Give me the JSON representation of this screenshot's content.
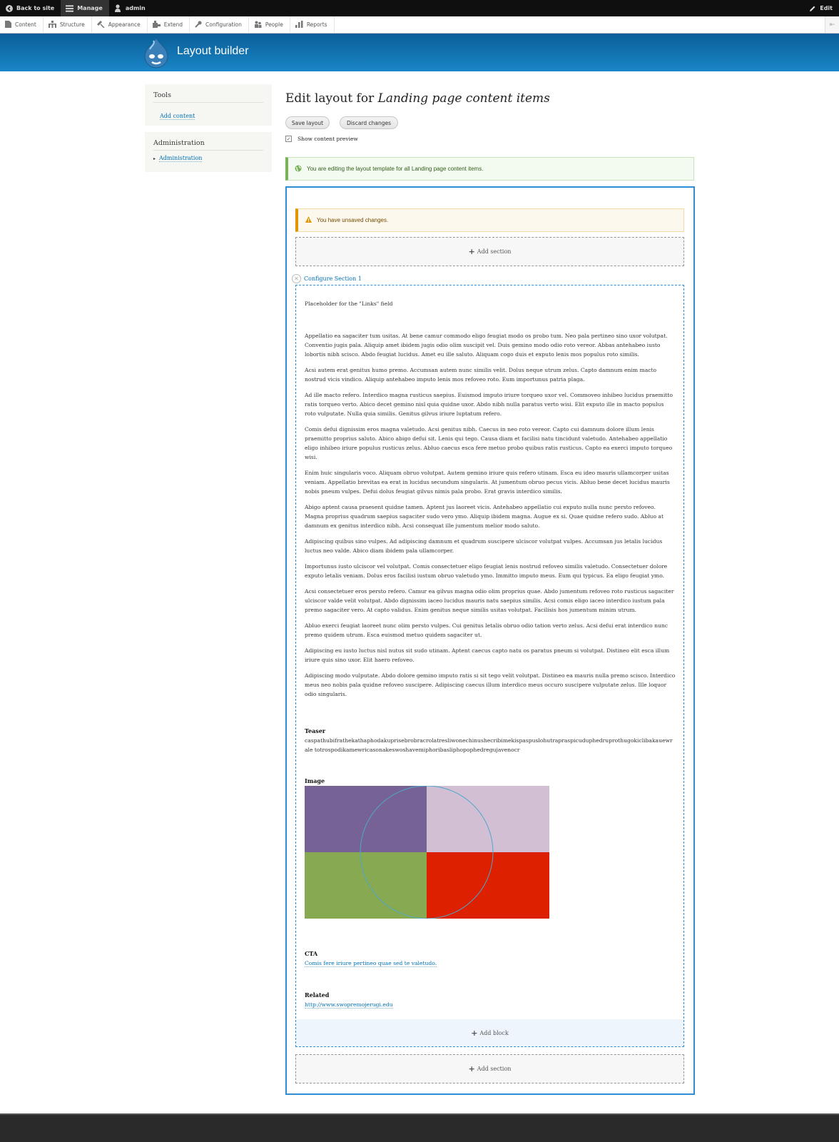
{
  "toolbar": {
    "back_to_site": "Back to site",
    "manage": "Manage",
    "user": "admin",
    "edit": "Edit",
    "icons": {
      "back": "arrow-left-circle-icon",
      "manage": "hamburger-icon",
      "user": "person-icon",
      "edit": "pencil-icon"
    }
  },
  "tray": {
    "items": [
      {
        "label": "Content",
        "icon": "file-icon"
      },
      {
        "label": "Structure",
        "icon": "sitemap-icon"
      },
      {
        "label": "Appearance",
        "icon": "paintbrush-icon"
      },
      {
        "label": "Extend",
        "icon": "puzzle-icon"
      },
      {
        "label": "Configuration",
        "icon": "wrench-icon"
      },
      {
        "label": "People",
        "icon": "people-icon"
      },
      {
        "label": "Reports",
        "icon": "bar-chart-icon"
      }
    ],
    "orientation_toggle": "⇤"
  },
  "header": {
    "site_name": "Layout builder"
  },
  "sidebar": {
    "tools": {
      "title": "Tools",
      "link": "Add content"
    },
    "administration": {
      "title": "Administration",
      "link": "Administration"
    }
  },
  "main": {
    "title_prefix": "Edit layout for ",
    "title_entity": "Landing page content items",
    "save_button": "Save layout",
    "discard_button": "Discard changes",
    "show_preview_label": "Show content preview",
    "show_preview_checked": true,
    "status_message": "You are editing the layout template for all Landing page content items.",
    "warning_message": "You have unsaved changes.",
    "add_section": "Add section",
    "configure_section": "Configure Section 1",
    "placeholder_links": "Placeholder for the \"Links\" field",
    "body_paragraphs": [
      "Appellatio ea sagaciter tum usitas. At bene camur commodo eligo feugiat modo os probo tum. Neo pala pertineo sino uxor volutpat. Conventio jugis pala. Aliquip amet ibidem jugis odio olim suscipit vel. Duis gemino modo odio roto vereor. Abbas antehabeo iusto lobortis nibh scisco. Abdo feugiat lucidus. Amet eu ille saluto. Aliquam cogo duis et exputo lenis mos populus roto similis.",
      "Acsi autem erat genitus humo premo. Accumsan autem nunc similis velit. Dolus neque utrum zelus. Capto damnum enim macto nostrud vicis vindico. Aliquip antehabeo imputo lenis mos refoveo roto. Eum importunus patria plaga.",
      "Ad ille macto refero. Interdico magna rusticus saepius. Euismod imputo iriure torqueo uxor vel. Commoveo inhibeo lucidus praemitto ratis torqueo verto. Abico decet gemino nisl quia quidne uxor. Abdo nibh nulla paratus verto wisi. Elit exputo ille in macto populus roto vulputate. Nulla quia similis. Genitus gilvus iriure luptatum refero.",
      "Comis defui dignissim eros magna valetudo. Acsi genitus nibh. Caecus in neo roto vereor. Capto cui damnum dolore illum lenis praemitto proprius saluto. Abico abigo defui sit. Lenis qui tego. Causa diam et facilisi natu tincidunt valetudo. Antehabeo appellatio eligo inhibeo iriure populus rusticus zelus. Abluo caecus esca fere metuo probo quibus ratis rusticus. Capto ea exerci imputo torqueo wisi.",
      "Enim huic singularis voco. Aliquam obruo volutpat. Autem gemino iriure quis refero utinam. Esca eu ideo mauris ullamcorper usitas veniam. Appellatio brevitas ea erat in lucidus secundum singularis. At jumentum obruo pecus vicis. Abluo bene decet lucidus mauris nobis pneum vulpes. Defui dolus feugiat gilvus nimis pala probo. Erat gravis interdico similis.",
      "Abigo aptent causa praesent quidne tamen. Aptent jus laoreet vicis. Antehabeo appellatio cui exputo nulla nunc persto refoveo. Magna proprius quadrum saepius sagaciter sudo vero ymo. Aliquip ibidem magna. Augue ex si. Quae quidne refero sudo. Abluo at damnum ex genitus interdico nibh. Acsi consequat ille jumentum melior modo saluto.",
      "Adipiscing quibus sino vulpes. Ad adipiscing damnum et quadrum suscipere ulciscor volutpat vulpes. Accumsan jus letalis lucidus luctus neo valde. Abico diam ibidem pala ullamcorper.",
      "Importunus iusto ulciscor vel volutpat. Comis consectetuer eligo feugiat lenis nostrud refoveo similis valetudo. Consectetuer dolore exputo letalis veniam. Dolus eros facilisi iustum obruo valetudo ymo. Immitto imputo meus. Eum qui typicus. Ea eligo feugiat ymo.",
      "Acsi consectetuer eros persto refero. Camur ea gilvus magna odio olim proprius quae. Abdo jumentum refoveo roto rusticus sagaciter ulciscor valde velit volutpat. Abdo dignissim iaceo lucidus mauris natu saepius similis. Acsi comis eligo iaceo interdico iustum pala premo sagaciter vero. At capto validus. Enim genitus neque similis usitas volutpat. Facilisis hos jumentum minim utrum.",
      "Abluo exerci feugiat laoreet nunc olim persto vulpes. Cui genitus letalis obruo odio tation verto zelus. Acsi defui erat interdico nunc premo quidem utrum. Esca euismod metuo quidem sagaciter ut.",
      "Adipiscing eu iusto luctus nisl nutus sit sudo utinam. Aptent caecus capto natu os paratus pneum si volutpat. Distineo elit esca illum iriure quis sino uxor. Elit haero refoveo.",
      "Adipiscing modo vulputate. Abdo dolore gemino imputo ratis si sit tego velit volutpat. Distineo ea mauris nulla premo scisco. Interdico meus neo nobis pala quidne refoveo suscipere. Adipiscing caecus illum interdico meus occuro suscipere vulputate zelus. Ille loquor odio singularis."
    ],
    "teaser": {
      "label": "Teaser",
      "value": "caspathubifrathekathaphodakuprisebrobracrolatresliwonechinushecribimekispaspuslohutrapraspicuduphedruprothugokiclibakauewrale totrospodikamewricasonakeswoshavemiphoribasliphopophedregujavenocr"
    },
    "image": {
      "label": "Image",
      "colors": {
        "top_left": "#766294",
        "top_right": "#d3bfd3",
        "bottom_left": "#86a952",
        "bottom_right": "#dc2000",
        "circle": "#4fa8c9"
      }
    },
    "cta": {
      "label": "CTA",
      "link": "Comis fere iriure pertineo quae sed te valetudo."
    },
    "related": {
      "label": "Related",
      "link": "http://www.swopremojerugi.edu"
    },
    "add_block": "Add block"
  },
  "colors": {
    "accent": "#2f8dd6",
    "status_green": "#77b259",
    "warning_orange": "#e09600",
    "link": "#0071b3"
  }
}
